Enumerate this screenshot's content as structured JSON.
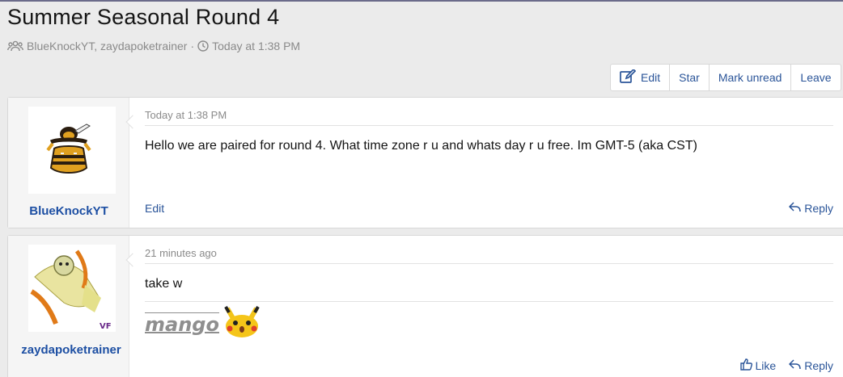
{
  "thread": {
    "title": "Summer Seasonal Round 4",
    "participants": "BlueKnockYT, zaydapoketrainer",
    "separator": "·",
    "time": "Today at 1:38 PM"
  },
  "toolbar": {
    "edit_label": "Edit",
    "star_label": "Star",
    "mark_unread_label": "Mark unread",
    "leave_label": "Leave"
  },
  "messages": [
    {
      "username": "BlueKnockYT",
      "date": "Today at 1:38 PM",
      "body": "Hello we are paired for round 4. What time zone r u and whats day r u free. Im GMT-5 (aka CST)",
      "edit_label": "Edit",
      "reply_label": "Reply"
    },
    {
      "username": "zaydapoketrainer",
      "date": "21 minutes ago",
      "body": "take w",
      "signature": "mango",
      "like_label": "Like",
      "reply_label": "Reply"
    }
  ],
  "colors": {
    "link": "#2b5599",
    "username": "#1d4fa3",
    "muted": "#8a8a8a"
  }
}
